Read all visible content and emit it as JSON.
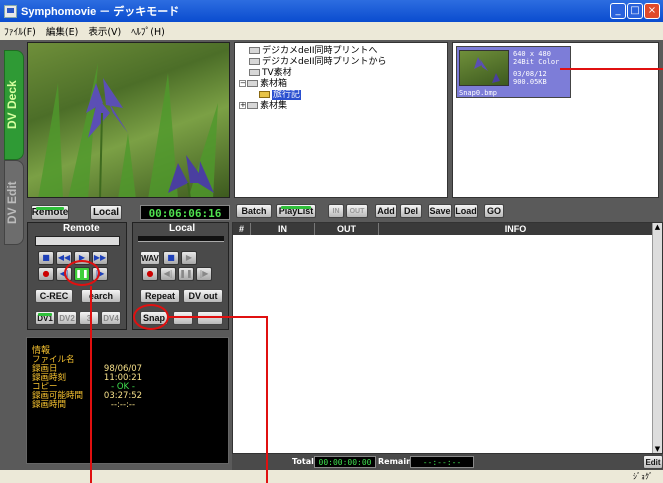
{
  "window": {
    "title": "Symphomovie － デッキモード",
    "min": "_",
    "max": "□",
    "close": "×"
  },
  "menu": [
    "ﾌｧｲﾙ(F)",
    "編集(E)",
    "表示(V)",
    "ﾍﾙﾌﾟ(H)"
  ],
  "sidetabs": {
    "deck": "DV Deck",
    "edit": "DV Edit"
  },
  "deck": {
    "remote_btn": "Remote",
    "local_btn": "Local",
    "timecode": "00:06:06:16",
    "remote_label": "Remote",
    "local_label": "Local",
    "wav": "WAV",
    "crec": "C-REC",
    "search": "earch",
    "repeat": "Repeat",
    "dvout": "DV out",
    "dv1": "DV1",
    "dv2": "DV2",
    "dv3": "3",
    "dv4": "DV4",
    "snap": "Snap"
  },
  "info": {
    "heading": "情報",
    "labels": [
      "ファイル名",
      "録画日",
      "録画時刻",
      "コピー",
      "録画可能時間",
      "録画時間"
    ],
    "values": [
      "98/06/07",
      "11:00:21",
      "- OK -",
      "03:27:52",
      "--:--:--"
    ]
  },
  "tree": [
    "デジカメdeII同時プリントへ",
    "デジカメdeII同時プリントから",
    "TV素材",
    "素材箱",
    "旅行記",
    "素材集"
  ],
  "thumb": {
    "res": "640 x 480",
    "depth": "24Bit Color",
    "date": "03/08/12",
    "size": "900.05KB",
    "file": "Snap0.bmp"
  },
  "toolbar": {
    "batch": "Batch",
    "playlist": "PlayList",
    "in": "IN",
    "out": "OUT",
    "add": "Add",
    "del": "Del",
    "save": "Save",
    "load": "Load",
    "go": "GO"
  },
  "list_headers": [
    "#",
    "IN",
    "OUT",
    "INFO"
  ],
  "bottom": {
    "total_label": "Total",
    "total_value": "00:00:00:00",
    "remain_label": "Remain",
    "remain_value": "--:--:--",
    "edit": "Edit"
  },
  "status": "ｼﾞｮｸﾞ"
}
